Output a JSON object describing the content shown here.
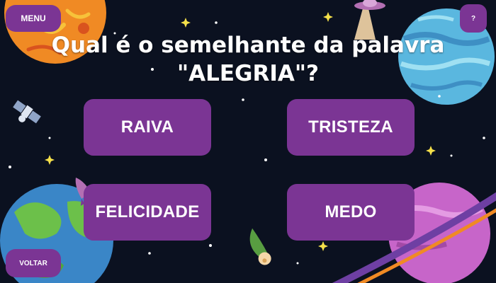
{
  "nav": {
    "menu_label": "MENU",
    "help_label": "?",
    "back_label": "VOLTAR"
  },
  "question": {
    "line1": "Qual é o semelhante da palavra",
    "line2": "\"ALEGRIA\"?"
  },
  "answers": [
    {
      "label": "RAIVA"
    },
    {
      "label": "TRISTEZA"
    },
    {
      "label": "FELICIDADE"
    },
    {
      "label": "MEDO"
    }
  ],
  "colors": {
    "background": "#0b1120",
    "button": "#7b3594",
    "text": "#ffffff"
  }
}
